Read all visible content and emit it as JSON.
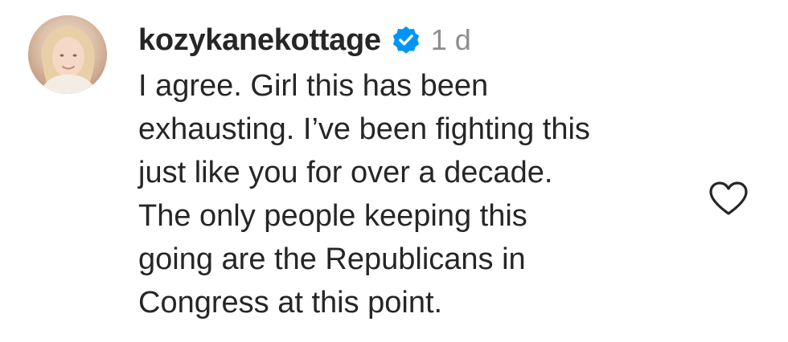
{
  "comment": {
    "username": "kozykanekottage",
    "timestamp": "1 d",
    "text": "I agree. Girl this has been\nexhausting. I’ve been fighting this\njust like you for over a decade.\nThe only people keeping this\ngoing are the Republicans in\nCongress at this point.",
    "verified": true,
    "avatar_icon": "profile-photo",
    "like_icon": "heart-outline-icon",
    "verified_icon": "verified-badge-icon"
  },
  "colors": {
    "text_primary": "#262626",
    "text_secondary": "#8e8e8e",
    "verified_blue": "#0095f6",
    "background": "#ffffff"
  }
}
